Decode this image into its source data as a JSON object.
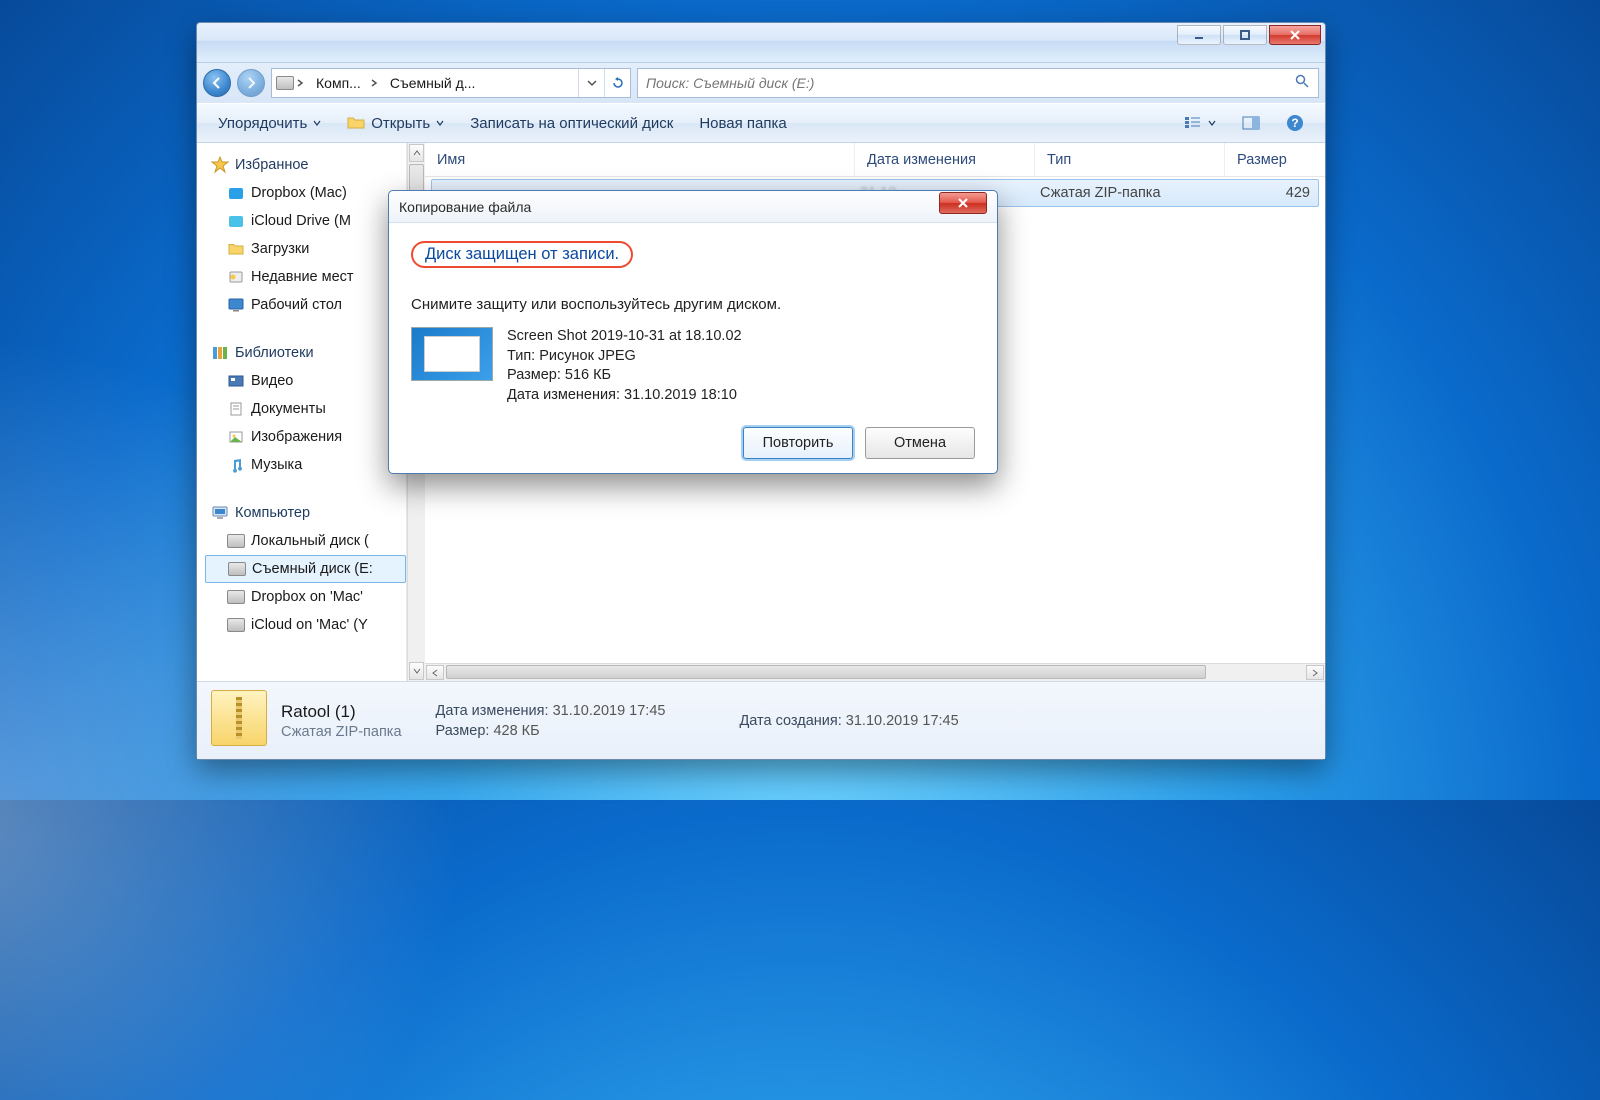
{
  "breadcrumbs": {
    "computer": "Комп...",
    "removable": "Съемный д..."
  },
  "search": {
    "placeholder": "Поиск: Съемный диск (E:)"
  },
  "toolbar": {
    "organize": "Упорядочить",
    "open": "Открыть",
    "burn": "Записать на оптический диск",
    "new_folder": "Новая папка"
  },
  "sidebar": {
    "favorites": "Избранное",
    "fav_items": [
      "Dropbox (Mac)",
      "iCloud Drive (M",
      "Загрузки",
      "Недавние мест",
      "Рабочий стол"
    ],
    "libraries": "Библиотеки",
    "lib_items": [
      "Видео",
      "Документы",
      "Изображения",
      "Музыка"
    ],
    "computer": "Компьютер",
    "comp_items": [
      "Локальный диск (",
      "Съемный диск (E:",
      "Dropbox on 'Mac'",
      "iCloud on 'Mac' (Y"
    ]
  },
  "columns": {
    "name": "Имя",
    "date": "Дата изменения",
    "type": "Тип",
    "size": "Размер"
  },
  "file_row": {
    "date": "31.10.",
    "type_label": "Сжатая ZIP-папка",
    "size": "429"
  },
  "details": {
    "name": "Ratool (1)",
    "type": "Сжатая ZIP-папка",
    "date_mod_label": "Дата изменения:",
    "date_mod": "31.10.2019 17:45",
    "date_created_label": "Дата создания:",
    "date_created": "31.10.2019 17:45",
    "size_label": "Размер:",
    "size": "428 КБ"
  },
  "dialog": {
    "title": "Копирование файла",
    "heading": "Диск защищен от записи.",
    "sub": "Снимите защиту или воспользуйтесь другим диском.",
    "file_name": "Screen Shot 2019-10-31 at 18.10.02",
    "file_type": "Тип: Рисунок JPEG",
    "file_size": "Размер: 516 КБ",
    "file_date": "Дата изменения: 31.10.2019 18:10",
    "retry": "Повторить",
    "cancel": "Отмена"
  }
}
